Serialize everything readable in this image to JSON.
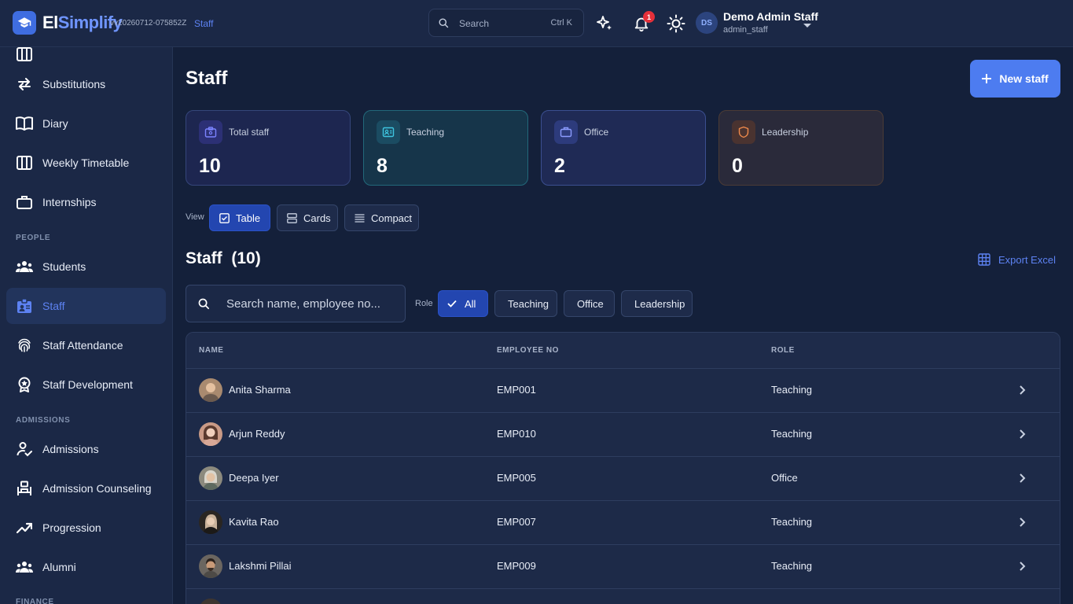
{
  "header": {
    "brand_part1": "El",
    "brand_part2": "Simplify",
    "version": "vv20260712-075852Z",
    "current_page": "Staff",
    "search_placeholder": "Search",
    "search_shortcut": "Ctrl K",
    "notification_count": "1",
    "user_initials": "DS",
    "user_name": "Demo Admin Staff",
    "user_handle": "admin_staff"
  },
  "sidebar": {
    "items_top": [
      {
        "label": "Substitutions",
        "icon": "swap-arrows-icon"
      },
      {
        "label": "Diary",
        "icon": "book-icon"
      },
      {
        "label": "Weekly Timetable",
        "icon": "calendar-grid-icon"
      },
      {
        "label": "Internships",
        "icon": "briefcase-icon"
      }
    ],
    "section_people": "PEOPLE",
    "items_people": [
      {
        "label": "Students",
        "icon": "group-icon"
      },
      {
        "label": "Staff",
        "icon": "id-badge-icon",
        "active": true
      },
      {
        "label": "Staff Attendance",
        "icon": "fingerprint-icon"
      },
      {
        "label": "Staff Development",
        "icon": "award-icon"
      }
    ],
    "section_admissions": "ADMISSIONS",
    "items_admissions": [
      {
        "label": "Admissions",
        "icon": "person-check-icon"
      },
      {
        "label": "Admission Counseling",
        "icon": "counseling-icon"
      },
      {
        "label": "Progression",
        "icon": "trending-up-icon"
      },
      {
        "label": "Alumni",
        "icon": "group-icon"
      }
    ],
    "section_finance": "FINANCE"
  },
  "main": {
    "title": "Staff",
    "new_button": "New staff",
    "stats": [
      {
        "label": "Total staff",
        "value": "10",
        "icon": "badge-icon"
      },
      {
        "label": "Teaching",
        "value": "8",
        "icon": "id-card-icon"
      },
      {
        "label": "Office",
        "value": "2",
        "icon": "briefcase-icon"
      },
      {
        "label": "Leadership",
        "value": "0",
        "icon": "shield-icon"
      }
    ],
    "view_label": "View",
    "views": [
      {
        "label": "Table",
        "active": true
      },
      {
        "label": "Cards",
        "active": false
      },
      {
        "label": "Compact",
        "active": false
      }
    ],
    "list_title": "Staff",
    "list_count": "(10)",
    "export_label": "Export Excel",
    "search_placeholder": "Search name, employee no...",
    "role_label": "Role",
    "role_filters": [
      {
        "label": "All",
        "active": true
      },
      {
        "label": "Teaching",
        "active": false
      },
      {
        "label": "Office",
        "active": false
      },
      {
        "label": "Leadership",
        "active": false
      }
    ],
    "columns": [
      "NAME",
      "EMPLOYEE NO",
      "ROLE"
    ],
    "rows": [
      {
        "name": "Anita Sharma",
        "employee_no": "EMP001",
        "role": "Teaching"
      },
      {
        "name": "Arjun Reddy",
        "employee_no": "EMP010",
        "role": "Teaching"
      },
      {
        "name": "Deepa Iyer",
        "employee_no": "EMP005",
        "role": "Office"
      },
      {
        "name": "Kavita Rao",
        "employee_no": "EMP007",
        "role": "Teaching"
      },
      {
        "name": "Lakshmi Pillai",
        "employee_no": "EMP009",
        "role": "Teaching"
      }
    ]
  },
  "colors": {
    "accent": "#4d7cf0",
    "active_text": "#5d82f2",
    "background": "#14203a",
    "panel": "#1b2846"
  }
}
